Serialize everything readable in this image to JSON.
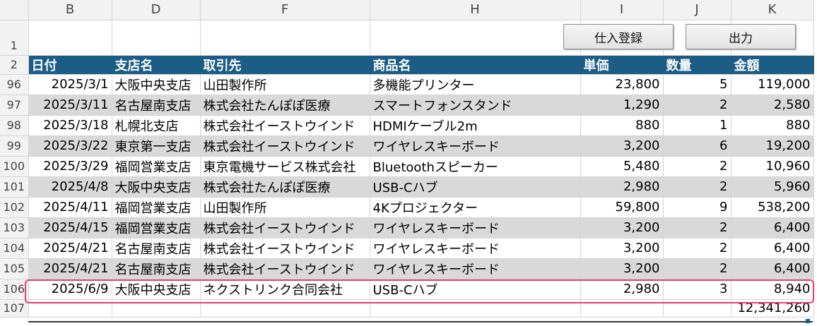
{
  "columns": [
    "B",
    "D",
    "F",
    "H",
    "I",
    "J",
    "K"
  ],
  "header_row_number": "2",
  "first_row_number": "1",
  "headers": [
    "日付",
    "支店名",
    "取引先",
    "商品名",
    "単価",
    "数量",
    "金額"
  ],
  "buttons": {
    "register": "仕入登録",
    "output": "出力"
  },
  "rows": [
    {
      "n": "96",
      "date": "2025/3/1",
      "branch": "大阪中央支店",
      "partner": "山田製作所",
      "product": "多機能プリンター",
      "price": "23,800",
      "qty": "5",
      "amount": "119,000"
    },
    {
      "n": "97",
      "date": "2025/3/11",
      "branch": "名古屋南支店",
      "partner": "株式会社たんぽぽ医療",
      "product": "スマートフォンスタンド",
      "price": "1,290",
      "qty": "2",
      "amount": "2,580"
    },
    {
      "n": "98",
      "date": "2025/3/18",
      "branch": "札幌北支店",
      "partner": "株式会社イーストウインド",
      "product": "HDMIケーブル2m",
      "price": "880",
      "qty": "1",
      "amount": "880"
    },
    {
      "n": "99",
      "date": "2025/3/22",
      "branch": "東京第一支店",
      "partner": "株式会社イーストウインド",
      "product": "ワイヤレスキーボード",
      "price": "3,200",
      "qty": "6",
      "amount": "19,200"
    },
    {
      "n": "100",
      "date": "2025/3/29",
      "branch": "福岡営業支店",
      "partner": "東京電機サービス株式会社",
      "product": "Bluetoothスピーカー",
      "price": "5,480",
      "qty": "2",
      "amount": "10,960"
    },
    {
      "n": "101",
      "date": "2025/4/8",
      "branch": "大阪中央支店",
      "partner": "株式会社たんぽぽ医療",
      "product": "USB-Cハブ",
      "price": "2,980",
      "qty": "2",
      "amount": "5,960"
    },
    {
      "n": "102",
      "date": "2025/4/11",
      "branch": "福岡営業支店",
      "partner": "山田製作所",
      "product": "4Kプロジェクター",
      "price": "59,800",
      "qty": "9",
      "amount": "538,200"
    },
    {
      "n": "103",
      "date": "2025/4/15",
      "branch": "福岡営業支店",
      "partner": "株式会社イーストウインド",
      "product": "ワイヤレスキーボード",
      "price": "3,200",
      "qty": "2",
      "amount": "6,400"
    },
    {
      "n": "104",
      "date": "2025/4/21",
      "branch": "名古屋南支店",
      "partner": "株式会社イーストウインド",
      "product": "ワイヤレスキーボード",
      "price": "3,200",
      "qty": "2",
      "amount": "6,400"
    },
    {
      "n": "105",
      "date": "2025/4/21",
      "branch": "名古屋南支店",
      "partner": "株式会社イーストウインド",
      "product": "ワイヤレスキーボード",
      "price": "3,200",
      "qty": "2",
      "amount": "6,400"
    },
    {
      "n": "106",
      "date": "2025/6/9",
      "branch": "大阪中央支店",
      "partner": "ネクストリンク合同会社",
      "product": "USB-Cハブ",
      "price": "2,980",
      "qty": "3",
      "amount": "8,940"
    }
  ],
  "total_row": {
    "n": "107",
    "amount": "12,341,260"
  },
  "colors": {
    "header_bg": "#1b5d84",
    "alt_row": "#d9d9d9",
    "highlight": "#e83e6c"
  }
}
